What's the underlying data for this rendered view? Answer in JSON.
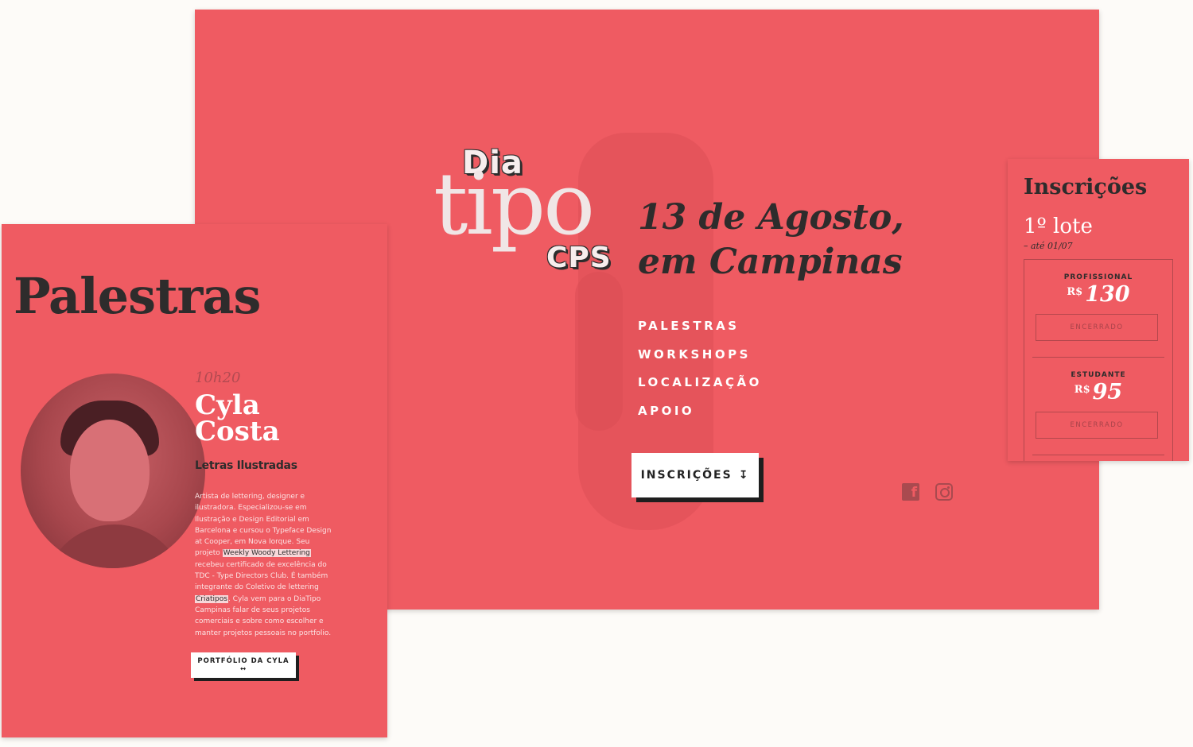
{
  "hero": {
    "logo": {
      "line1": "Dia",
      "line2": "tipo",
      "line3": "CPS"
    },
    "date_line1": "13 de Agosto,",
    "date_line2": "em Campinas",
    "nav": [
      "PALESTRAS",
      "WORKSHOPS",
      "LOCALIZAÇÃO",
      "APOIO"
    ],
    "cta_label": "INSCRIÇÕES",
    "cta_icon": "↧",
    "social": {
      "facebook_icon": "facebook-icon",
      "instagram_icon": "instagram-icon",
      "facebook_glyph": "f"
    }
  },
  "inscricoes": {
    "title": "Inscrições",
    "lote": "1º lote",
    "lote_date": "– até 01/07",
    "tiers": [
      {
        "label": "PROFISSIONAL",
        "currency": "R$",
        "price": "130",
        "button": "ENCERRADO"
      },
      {
        "label": "ESTUDANTE",
        "currency": "R$",
        "price": "95",
        "button": "ENCERRADO"
      }
    ]
  },
  "palestras": {
    "title": "Palestras",
    "time": "10h20",
    "speaker_first": "Cyla",
    "speaker_last": "Costa",
    "talk_title": "Letras Ilustradas",
    "bio_part1": "Artista de lettering, designer e ilustradora. Especializou-se em Ilustração e Design Editorial em Barcelona e cursou o Typeface Design at Cooper, em Nova Iorque. Seu projeto ",
    "bio_link1": "Weekly Woody Lettering",
    "bio_part2": " recebeu certificado de excelência do TDC - Type Directors Club. É também integrante do Coletivo de lettering ",
    "bio_link2": "Criatipos",
    "bio_part3": ". Cyla vem para o DiaTipo Campinas falar de seus projetos comerciais e sobre como escolher e manter projetos pessoais no portfolio.",
    "button": "PORTFÓLIO DA CYLA ↔"
  },
  "colors": {
    "accent": "#ef5b62",
    "dark": "#2e2c2c",
    "background": "#fdfbf8"
  }
}
